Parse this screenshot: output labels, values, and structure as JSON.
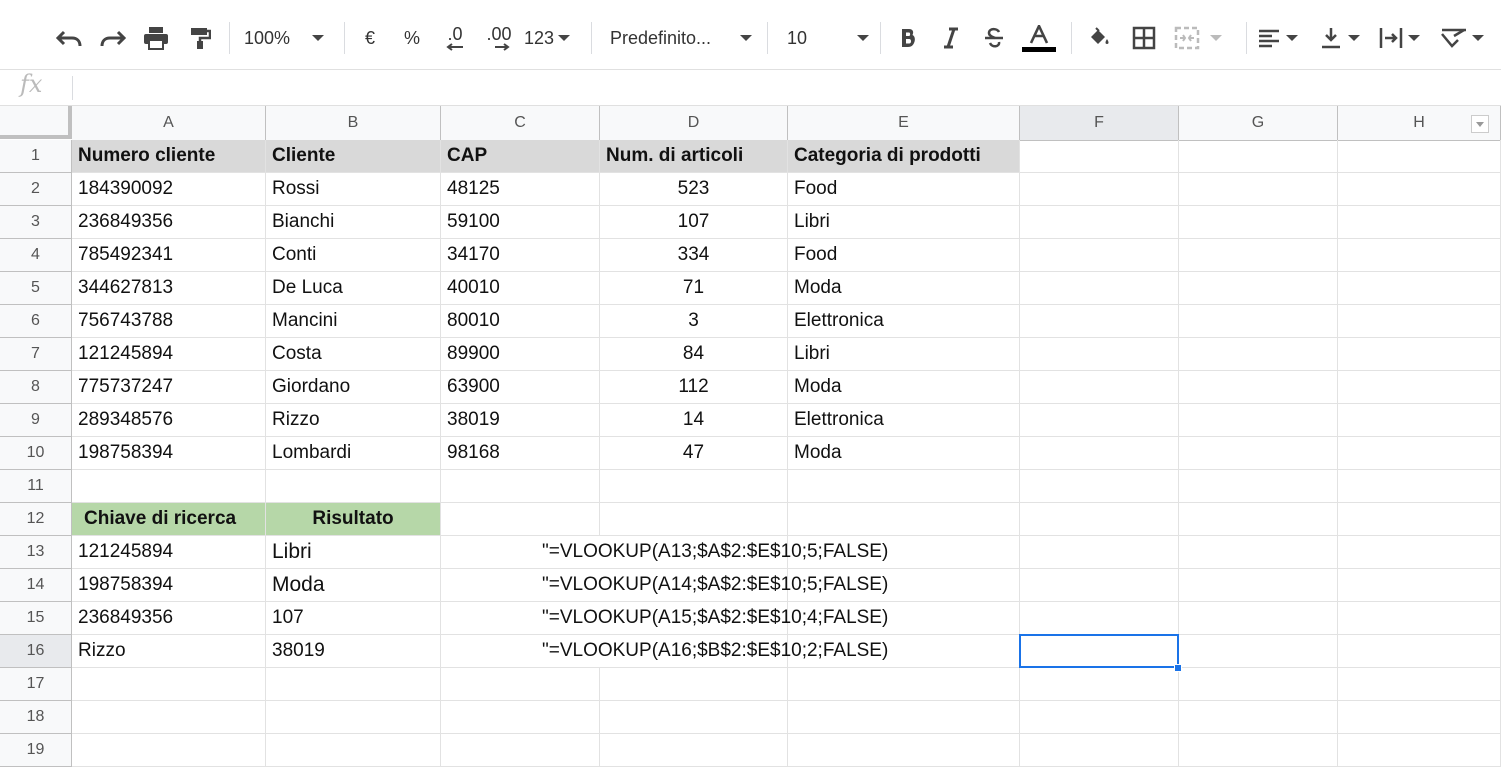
{
  "toolbar": {
    "zoom": "100%",
    "currency": "€",
    "percent": "%",
    "decrease_decimals": ".0",
    "increase_decimals": ".00",
    "number_format": "123",
    "font": "Predefinito...",
    "font_size": "10",
    "icons": [
      "undo-icon",
      "redo-icon",
      "print-icon",
      "paint-format-icon",
      "bold-icon",
      "italic-icon",
      "strikethrough-icon",
      "text-color-icon",
      "fill-color-icon",
      "borders-icon",
      "merge-cells-icon",
      "horizontal-align-icon",
      "vertical-align-icon",
      "text-wrapping-icon",
      "text-rotation-icon"
    ],
    "text_color": "#000000"
  },
  "formula_bar": {
    "fx_label": "fx",
    "value": ""
  },
  "columns": [
    "A",
    "B",
    "C",
    "D",
    "E",
    "F",
    "G",
    "H"
  ],
  "rows": [
    "1",
    "2",
    "3",
    "4",
    "5",
    "6",
    "7",
    "8",
    "9",
    "10",
    "11",
    "12",
    "13",
    "14",
    "15",
    "16",
    "17",
    "18",
    "19"
  ],
  "header_row": [
    "Numero cliente",
    "Cliente",
    "CAP",
    "Num. di articoli",
    "Categoria di prodotti"
  ],
  "table": [
    [
      "184390092",
      "Rossi",
      "48125",
      "523",
      "Food"
    ],
    [
      "236849356",
      "Bianchi",
      "59100",
      "107",
      "Libri"
    ],
    [
      "785492341",
      "Conti",
      "34170",
      "334",
      "Food"
    ],
    [
      "344627813",
      "De Luca",
      "40010",
      "71",
      "Moda"
    ],
    [
      "756743788",
      "Mancini",
      "80010",
      "3",
      "Elettronica"
    ],
    [
      "121245894",
      "Costa",
      "89900",
      "84",
      "Libri"
    ],
    [
      "775737247",
      "Giordano",
      "63900",
      "112",
      "Moda"
    ],
    [
      "289348576",
      "Rizzo",
      "38019",
      "14",
      "Elettronica"
    ],
    [
      "198758394",
      "Lombardi",
      "98168",
      "47",
      "Moda"
    ]
  ],
  "lookup_header": [
    "Chiave di ricerca",
    "Risultato"
  ],
  "lookup_rows": [
    {
      "key": "121245894",
      "result": "Libri",
      "formula": "\"=VLOOKUP(A13;$A$2:$E$10;5;FALSE)"
    },
    {
      "key": "198758394",
      "result": "Moda",
      "formula": "\"=VLOOKUP(A14;$A$2:$E$10;5;FALSE)"
    },
    {
      "key": "236849356",
      "result": "107",
      "formula": "\"=VLOOKUP(A15;$A$2:$E$10;4;FALSE)"
    },
    {
      "key": "Rizzo",
      "result": "38019",
      "formula": "\"=VLOOKUP(A16;$B$2:$E$10;2;FALSE)"
    }
  ],
  "colors": {
    "header_fill": "#d9d9d9",
    "lookup_header_fill": "#b6d7a8",
    "selection": "#1a73e8"
  },
  "selected_cell": "F16"
}
